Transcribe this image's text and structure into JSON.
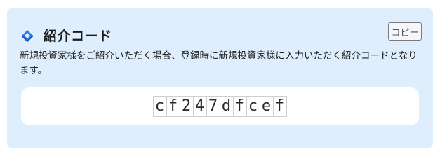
{
  "card": {
    "title": "紹介コード",
    "icon": "layered-diamond-icon",
    "accent_color": "#2b7de0",
    "copy_label": "コピー",
    "description": "新規投資家様をご紹介いただく場合、登録時に新規投資家様に入力いただく紹介コードとなります。",
    "code": "cf247dfcef"
  }
}
